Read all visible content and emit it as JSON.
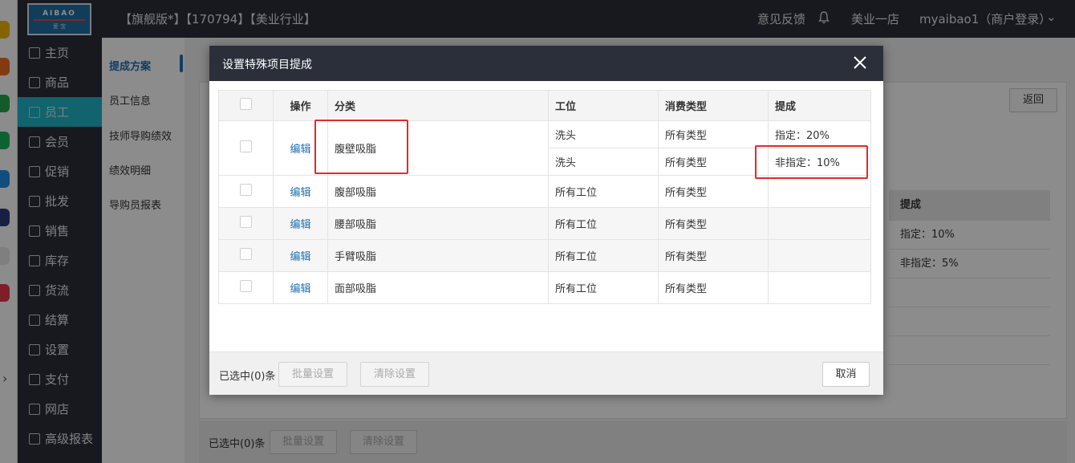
{
  "header": {
    "edition": "【旗舰版*】【170794】【美业行业】",
    "feedback": "意见反馈",
    "store": "美业一店",
    "user": "myaibao1（商户登录）"
  },
  "logo": {
    "text": "AIBAO",
    "sub": "爱 宝"
  },
  "sidebar": {
    "items": [
      {
        "label": "主页"
      },
      {
        "label": "商品"
      },
      {
        "label": "员工"
      },
      {
        "label": "会员"
      },
      {
        "label": "促销"
      },
      {
        "label": "批发"
      },
      {
        "label": "销售"
      },
      {
        "label": "库存"
      },
      {
        "label": "货流"
      },
      {
        "label": "结算"
      },
      {
        "label": "设置"
      },
      {
        "label": "支付"
      },
      {
        "label": "网店"
      },
      {
        "label": "高级报表"
      }
    ]
  },
  "submenu": {
    "items": [
      {
        "label": "提成方案"
      },
      {
        "label": "员工信息"
      },
      {
        "label": "技师导购绩效"
      },
      {
        "label": "绩效明细"
      },
      {
        "label": "导购员报表"
      }
    ]
  },
  "background": {
    "back_button": "返回",
    "table": {
      "header": "提成",
      "rows": [
        "指定：10%",
        "非指定：5%",
        "",
        "",
        ""
      ]
    },
    "selected": "已选中(0)条",
    "batch_button": "批量设置",
    "clear_button": "清除设置"
  },
  "modal": {
    "title": "设置特殊项目提成",
    "columns": {
      "action": "操作",
      "category": "分类",
      "station": "工位",
      "consume_type": "消费类型",
      "commission": "提成"
    },
    "edit_label": "编辑",
    "rows": [
      {
        "category": "腹壁吸脂",
        "sub": [
          {
            "station": "洗头",
            "consume_type": "所有类型",
            "commission": "指定：20%"
          },
          {
            "station": "洗头",
            "consume_type": "所有类型",
            "commission": "非指定：10%"
          }
        ]
      },
      {
        "category": "腹部吸脂",
        "station": "所有工位",
        "consume_type": "所有类型",
        "commission": ""
      },
      {
        "category": "腰部吸脂",
        "station": "所有工位",
        "consume_type": "所有类型",
        "commission": ""
      },
      {
        "category": "手臂吸脂",
        "station": "所有工位",
        "consume_type": "所有类型",
        "commission": ""
      },
      {
        "category": "面部吸脂",
        "station": "所有工位",
        "consume_type": "所有类型",
        "commission": ""
      }
    ],
    "footer": {
      "selected": "已选中(0)条",
      "batch_button": "批量设置",
      "clear_button": "清除设置",
      "cancel_button": "取消"
    }
  },
  "colors": {
    "accent": "#1f6fb5",
    "active_nav": "#20b4c8",
    "highlight": "#e12a2a",
    "dark": "#2b2f3a"
  }
}
